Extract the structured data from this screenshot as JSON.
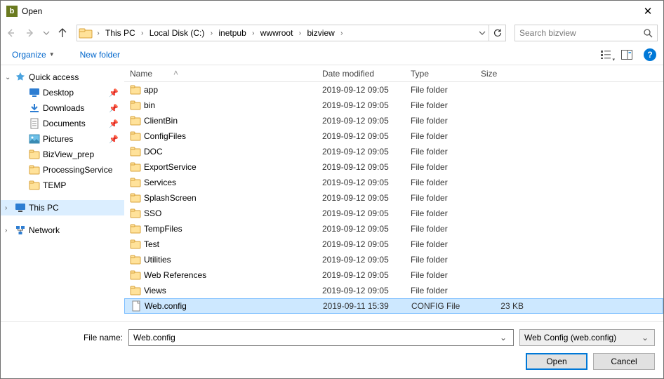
{
  "window": {
    "title": "Open"
  },
  "nav": {
    "breadcrumb": [
      "This PC",
      "Local Disk (C:)",
      "inetpub",
      "wwwroot",
      "bizview"
    ],
    "search_placeholder": "Search bizview"
  },
  "toolbar": {
    "organize_label": "Organize",
    "new_folder_label": "New folder"
  },
  "tree": {
    "quick_access": "Quick access",
    "desktop": "Desktop",
    "downloads": "Downloads",
    "documents": "Documents",
    "pictures": "Pictures",
    "bizview_prep": "BizView_prep",
    "processing": "ProcessingService",
    "temp": "TEMP",
    "this_pc": "This PC",
    "network": "Network"
  },
  "columns": {
    "name": "Name",
    "date": "Date modified",
    "type": "Type",
    "size": "Size"
  },
  "files": [
    {
      "name": "app",
      "date": "2019-09-12 09:05",
      "type": "File folder",
      "size": "",
      "kind": "folder"
    },
    {
      "name": "bin",
      "date": "2019-09-12 09:05",
      "type": "File folder",
      "size": "",
      "kind": "folder"
    },
    {
      "name": "ClientBin",
      "date": "2019-09-12 09:05",
      "type": "File folder",
      "size": "",
      "kind": "folder"
    },
    {
      "name": "ConfigFiles",
      "date": "2019-09-12 09:05",
      "type": "File folder",
      "size": "",
      "kind": "folder"
    },
    {
      "name": "DOC",
      "date": "2019-09-12 09:05",
      "type": "File folder",
      "size": "",
      "kind": "folder"
    },
    {
      "name": "ExportService",
      "date": "2019-09-12 09:05",
      "type": "File folder",
      "size": "",
      "kind": "folder"
    },
    {
      "name": "Services",
      "date": "2019-09-12 09:05",
      "type": "File folder",
      "size": "",
      "kind": "folder"
    },
    {
      "name": "SplashScreen",
      "date": "2019-09-12 09:05",
      "type": "File folder",
      "size": "",
      "kind": "folder"
    },
    {
      "name": "SSO",
      "date": "2019-09-12 09:05",
      "type": "File folder",
      "size": "",
      "kind": "folder"
    },
    {
      "name": "TempFiles",
      "date": "2019-09-12 09:05",
      "type": "File folder",
      "size": "",
      "kind": "folder"
    },
    {
      "name": "Test",
      "date": "2019-09-12 09:05",
      "type": "File folder",
      "size": "",
      "kind": "folder"
    },
    {
      "name": "Utilities",
      "date": "2019-09-12 09:05",
      "type": "File folder",
      "size": "",
      "kind": "folder"
    },
    {
      "name": "Web References",
      "date": "2019-09-12 09:05",
      "type": "File folder",
      "size": "",
      "kind": "folder"
    },
    {
      "name": "Views",
      "date": "2019-09-12 09:05",
      "type": "File folder",
      "size": "",
      "kind": "folder"
    },
    {
      "name": "Web.config",
      "date": "2019-09-11 15:39",
      "type": "CONFIG File",
      "size": "23 KB",
      "kind": "file",
      "selected": true
    }
  ],
  "footer": {
    "filename_label": "File name:",
    "filename_value": "Web.config",
    "filter_label": "Web Config (web.config)",
    "open_label": "Open",
    "cancel_label": "Cancel"
  }
}
